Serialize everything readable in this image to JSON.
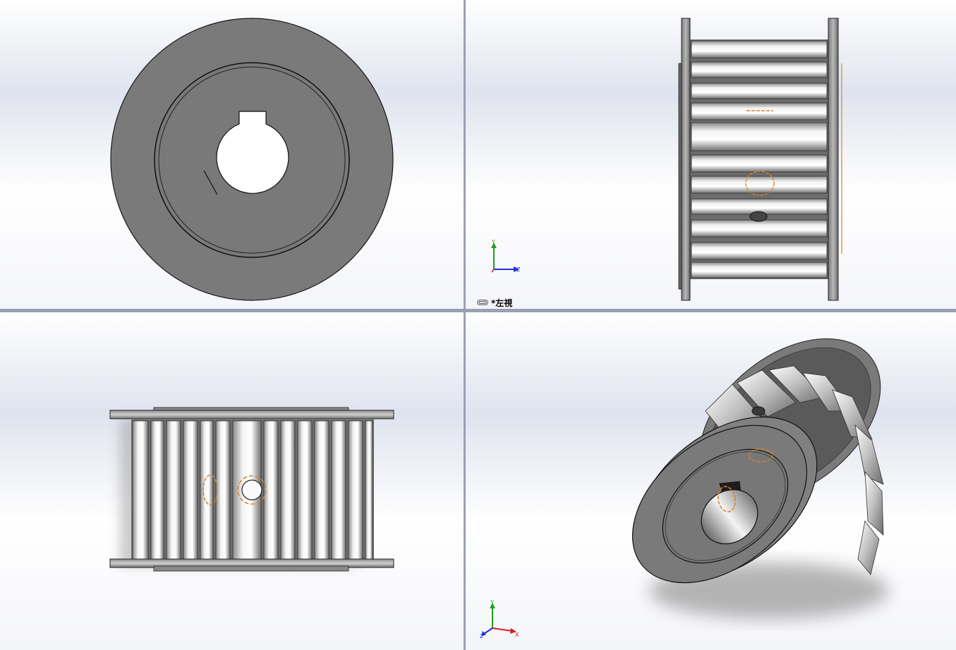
{
  "viewports": [
    {
      "id": "front",
      "label": ""
    },
    {
      "id": "left",
      "label": "*左視",
      "icon": "view-link-icon"
    },
    {
      "id": "top",
      "label": ""
    },
    {
      "id": "isometric",
      "label": ""
    }
  ],
  "triad_left": {
    "y": "Y",
    "z": "Z"
  },
  "triad_iso": {
    "y": "Y",
    "x": "X",
    "z": "Z"
  },
  "colors": {
    "pulley_face": "#7a7a7a",
    "hidden_edge": "#d9822b",
    "axis_x": "#d02020",
    "axis_y": "#20a020",
    "axis_z": "#2030d0",
    "viewport_border": "#9aa0b4"
  }
}
